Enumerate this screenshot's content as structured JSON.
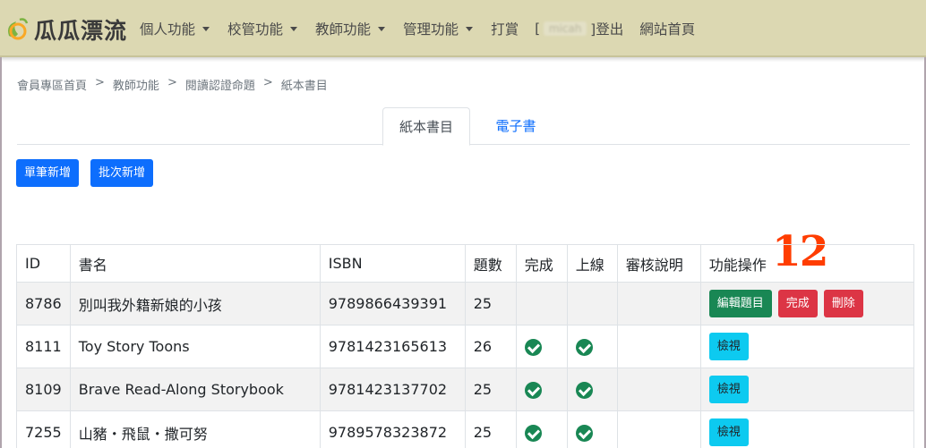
{
  "nav": {
    "brand": "瓜瓜漂流",
    "menus": [
      {
        "label": "個人功能"
      },
      {
        "label": "校管功能"
      },
      {
        "label": "教師功能"
      },
      {
        "label": "管理功能"
      }
    ],
    "donate": "打賞",
    "user_prefix": "[",
    "user_name": "micah",
    "user_suffix": "]登出",
    "home": "網站首頁"
  },
  "breadcrumb": {
    "items": [
      "會員專區首頁",
      "教師功能",
      "閱讀認證命題",
      "紙本書目"
    ],
    "separator": ">"
  },
  "tabs": {
    "active": "紙本書目",
    "other": "電子書"
  },
  "buttons": {
    "single_add": "單筆新增",
    "batch_add": "批次新增"
  },
  "annotation": "12",
  "table": {
    "headers": [
      "ID",
      "書名",
      "ISBN",
      "題數",
      "完成",
      "上線",
      "審核說明",
      "功能操作"
    ],
    "rows": [
      {
        "id": "8786",
        "title": "別叫我外籍新娘的小孩",
        "isbn": "9789866439391",
        "count": "25",
        "done": false,
        "online": false,
        "review": "",
        "actions": [
          "編輯題目",
          "完成",
          "刪除"
        ]
      },
      {
        "id": "8111",
        "title": "Toy Story Toons",
        "isbn": "9781423165613",
        "count": "26",
        "done": true,
        "online": true,
        "review": "",
        "actions": [
          "檢視"
        ]
      },
      {
        "id": "8109",
        "title": "Brave Read-Along Storybook",
        "isbn": "9781423137702",
        "count": "25",
        "done": true,
        "online": true,
        "review": "",
        "actions": [
          "檢視"
        ]
      },
      {
        "id": "7255",
        "title": "山豬・飛鼠・撒可努",
        "isbn": "9789578323872",
        "count": "25",
        "done": true,
        "online": true,
        "review": "",
        "actions": [
          "檢視"
        ]
      }
    ]
  },
  "colors": {
    "navbar": "#dcd8b2",
    "primary": "#0d6efd",
    "success": "#198754",
    "danger": "#dc3545",
    "info": "#0dcaf0",
    "annotation": "#ff3d00"
  },
  "icons": {
    "brand": "melon-logo-icon",
    "caret": "caret-down-icon",
    "check": "check-circle-icon"
  }
}
